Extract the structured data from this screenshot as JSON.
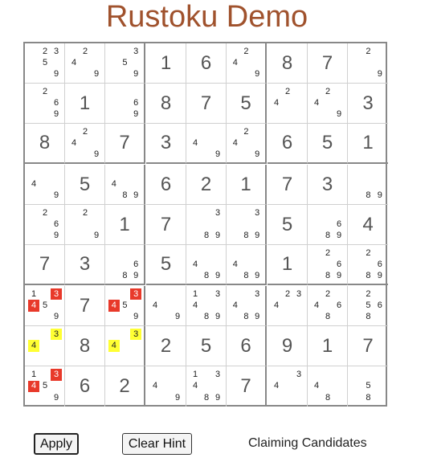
{
  "title": "Rustoku Demo",
  "colors": {
    "title": "#a0522d",
    "highlight_red": "#e8392a",
    "highlight_yellow": "#ffff33"
  },
  "buttons": {
    "apply": "Apply",
    "clear_hint": "Clear Hint"
  },
  "hint_name": "Claiming Candidates",
  "grid": [
    [
      {
        "c": [
          2,
          3,
          5,
          9
        ]
      },
      {
        "c": [
          2,
          4,
          9
        ]
      },
      {
        "c": [
          3,
          5,
          9
        ]
      },
      {
        "v": 1
      },
      {
        "v": 6
      },
      {
        "c": [
          2,
          4,
          9
        ]
      },
      {
        "v": 8
      },
      {
        "v": 7
      },
      {
        "c": [
          2,
          9
        ]
      }
    ],
    [
      {
        "c": [
          2,
          6,
          9
        ]
      },
      {
        "v": 1
      },
      {
        "c": [
          6,
          9
        ]
      },
      {
        "v": 8
      },
      {
        "v": 7
      },
      {
        "v": 5
      },
      {
        "c": [
          2,
          4
        ]
      },
      {
        "c": [
          2,
          4,
          9
        ]
      },
      {
        "v": 3
      }
    ],
    [
      {
        "v": 8
      },
      {
        "c": [
          2,
          4,
          9
        ]
      },
      {
        "v": 7
      },
      {
        "v": 3
      },
      {
        "c": [
          4,
          9
        ]
      },
      {
        "c": [
          2,
          4,
          9
        ]
      },
      {
        "v": 6
      },
      {
        "v": 5
      },
      {
        "v": 1
      }
    ],
    [
      {
        "c": [
          4,
          9
        ]
      },
      {
        "v": 5
      },
      {
        "c": [
          4,
          8,
          9
        ]
      },
      {
        "v": 6
      },
      {
        "v": 2
      },
      {
        "v": 1
      },
      {
        "v": 7
      },
      {
        "v": 3
      },
      {
        "c": [
          8,
          9
        ]
      }
    ],
    [
      {
        "c": [
          2,
          6,
          9
        ]
      },
      {
        "c": [
          2,
          9
        ]
      },
      {
        "v": 1
      },
      {
        "v": 7
      },
      {
        "c": [
          3,
          8,
          9
        ]
      },
      {
        "c": [
          3,
          8,
          9
        ]
      },
      {
        "v": 5
      },
      {
        "c": [
          6,
          8,
          9
        ]
      },
      {
        "v": 4
      }
    ],
    [
      {
        "v": 7
      },
      {
        "v": 3
      },
      {
        "c": [
          6,
          8,
          9
        ]
      },
      {
        "v": 5
      },
      {
        "c": [
          4,
          8,
          9
        ]
      },
      {
        "c": [
          4,
          8,
          9
        ]
      },
      {
        "v": 1
      },
      {
        "c": [
          2,
          6,
          8,
          9
        ]
      },
      {
        "c": [
          2,
          6,
          8,
          9
        ]
      }
    ],
    [
      {
        "c": [
          1,
          3,
          4,
          5,
          9
        ],
        "red": [
          3,
          4
        ]
      },
      {
        "v": 7
      },
      {
        "c": [
          3,
          4,
          5,
          9
        ],
        "red": [
          3,
          4
        ]
      },
      {
        "c": [
          4,
          9
        ]
      },
      {
        "c": [
          1,
          3,
          4,
          8,
          9
        ]
      },
      {
        "c": [
          3,
          4,
          8,
          9
        ]
      },
      {
        "c": [
          2,
          3,
          4
        ]
      },
      {
        "c": [
          2,
          4,
          6,
          8
        ]
      },
      {
        "c": [
          2,
          5,
          6,
          8
        ]
      }
    ],
    [
      {
        "c": [
          3,
          4
        ],
        "yellow": [
          3,
          4
        ]
      },
      {
        "v": 8
      },
      {
        "c": [
          3,
          4
        ],
        "yellow": [
          3,
          4
        ]
      },
      {
        "v": 2
      },
      {
        "v": 5
      },
      {
        "v": 6
      },
      {
        "v": 9
      },
      {
        "v": 1
      },
      {
        "v": 7
      }
    ],
    [
      {
        "c": [
          1,
          3,
          4,
          5,
          9
        ],
        "red": [
          3,
          4
        ]
      },
      {
        "v": 6
      },
      {
        "v": 2
      },
      {
        "c": [
          4,
          9
        ]
      },
      {
        "c": [
          1,
          3,
          4,
          8,
          9
        ]
      },
      {
        "v": 7
      },
      {
        "c": [
          3,
          4
        ]
      },
      {
        "c": [
          4,
          8
        ]
      },
      {
        "c": [
          5,
          8
        ]
      }
    ]
  ]
}
